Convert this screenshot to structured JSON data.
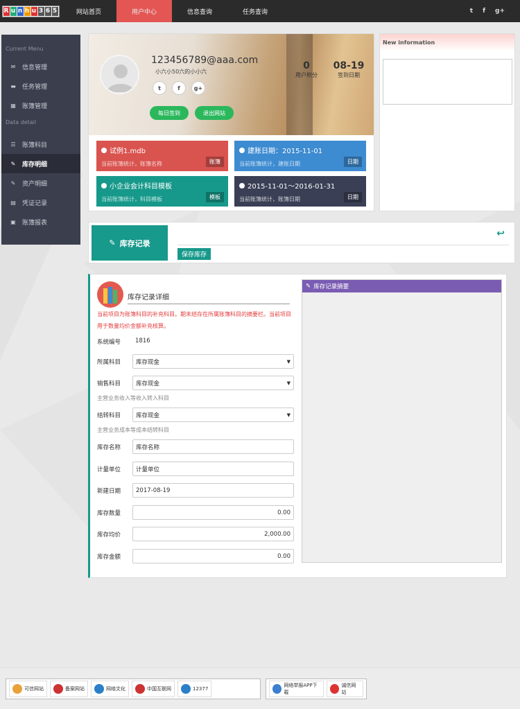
{
  "logo": {
    "letters": [
      "R",
      "u",
      "n",
      "h",
      "u",
      "3",
      "6",
      "5"
    ],
    "colors": [
      "#d33",
      "#2a7",
      "#36c",
      "#e90",
      "#d33",
      "#555",
      "#555",
      "#555"
    ]
  },
  "nav": {
    "items": [
      "网站首页",
      "用户中心",
      "信息查询",
      "任务查询"
    ],
    "active": "用户中心"
  },
  "social": {
    "twitter": "t",
    "facebook": "f",
    "gplus": "g+"
  },
  "sidebar": {
    "section1": "Current Menu",
    "section2": "Data detail",
    "items": [
      {
        "label": "信息管理",
        "icon": "envelope-icon"
      },
      {
        "label": "任务管理",
        "icon": "folder-icon"
      },
      {
        "label": "账簿管理",
        "icon": "grid-icon"
      },
      {
        "label": "账簿科目",
        "icon": "list-icon"
      },
      {
        "label": "库存明细",
        "icon": "edit-icon"
      },
      {
        "label": "资产明细",
        "icon": "edit-icon"
      },
      {
        "label": "凭证记录",
        "icon": "file-icon"
      },
      {
        "label": "账簿报表",
        "icon": "briefcase-icon"
      }
    ],
    "active": "库存明细"
  },
  "profile": {
    "email": "123456789@aaa.com",
    "subname": "小六小50六的小小六",
    "social": [
      "t",
      "f",
      "g+"
    ],
    "checkin": "每日签到",
    "logout": "退出网站",
    "stats": [
      {
        "num": "0",
        "label": "用户积分"
      },
      {
        "num": "08-19",
        "label": "签到日期"
      }
    ]
  },
  "tiles": [
    {
      "title": "试例1.mdb",
      "sub": "当前账簿统计，账簿名称",
      "badge": "账簿",
      "color": "#d9534f"
    },
    {
      "title": "建账日期：2015-11-01",
      "sub": "当前账簿统计，建账日期",
      "badge": "日期",
      "color": "#3d8bd1"
    },
    {
      "title": "小企业会计科目模板",
      "sub": "当前账簿统计，科目模板",
      "badge": "模板",
      "color": "#16998a"
    },
    {
      "title": "2015-11-01～2016-01-31",
      "sub": "当前账簿统计，账簿日期",
      "badge": "日期",
      "color": "#3a3f55"
    }
  ],
  "newinfo": {
    "title": "New information"
  },
  "record": {
    "title": "库存记录",
    "save": "保存库存"
  },
  "form": {
    "title": "库存记录详细",
    "note": "当前项目为账簿科目的补充科目。期末结存在所属账簿科目的摘要栏。当前项目用于数量均价金额补充核算。",
    "sys_label": "系统编号",
    "sys_value": "1816",
    "fields": {
      "subject": {
        "label": "所属科目",
        "value": "库存现金"
      },
      "sales": {
        "label": "销售科目",
        "value": "库存现金",
        "hint": "主营业务收入等收入转入科目"
      },
      "carry": {
        "label": "结转科目",
        "value": "库存现金",
        "hint": "主营业务成本等成本结转科目"
      },
      "name": {
        "label": "库存名称",
        "value": "库存名称"
      },
      "unit": {
        "label": "计量单位",
        "value": "计量单位"
      },
      "date": {
        "label": "新建日期",
        "value": "2017-08-19"
      },
      "qty": {
        "label": "库存数量",
        "value": "0.00"
      },
      "price": {
        "label": "库存均价",
        "value": "2,000.00"
      },
      "amount": {
        "label": "库存金额",
        "value": "0.00"
      }
    },
    "summary_title": "库存记录摘要"
  },
  "footer": {
    "group1": [
      "可信网站",
      "备案网站",
      "网络文化",
      "中国互联网",
      "12377"
    ],
    "group2": [
      "网络举报APP下载",
      "诚信网站"
    ]
  }
}
